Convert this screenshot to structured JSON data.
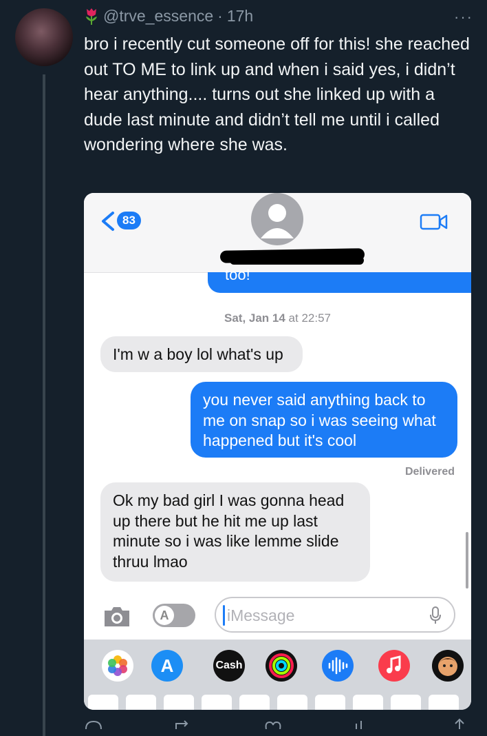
{
  "tweet": {
    "handle": "@trve_essence",
    "time": "17h",
    "separator": "·",
    "more": "···",
    "text": "bro i recently cut someone off for this! she reached out TO ME to link up and when i said yes, i didn’t hear anything.... turns out she linked up with a dude last minute and didn’t tell me until i called wondering where she was."
  },
  "screenshot": {
    "back_badge": "83",
    "cutoff_text": "too!",
    "timestamp_day": "Sat, Jan 14",
    "timestamp_time": " at 22:57",
    "messages": [
      {
        "dir": "in",
        "text": "I'm w a boy lol what's up"
      },
      {
        "dir": "out",
        "text": "you never said anything back to me on snap so i was seeing what happened but it's cool"
      },
      {
        "dir": "in",
        "text": "Ok my bad girl I was gonna head up there but he hit me up last minute so i was like lemme slide thruu lmao"
      }
    ],
    "delivered": "Delivered",
    "input_placeholder": "iMessage",
    "apps": [
      "photos-icon",
      "appstore-icon",
      "Cash",
      "fitness-icon",
      "voice-memo-icon",
      "music-icon",
      "memoji-icon"
    ]
  },
  "colors": {
    "imessage_blue": "#1c7cf6",
    "bubble_gray": "#e9e9eb",
    "bg": "#15202b"
  }
}
